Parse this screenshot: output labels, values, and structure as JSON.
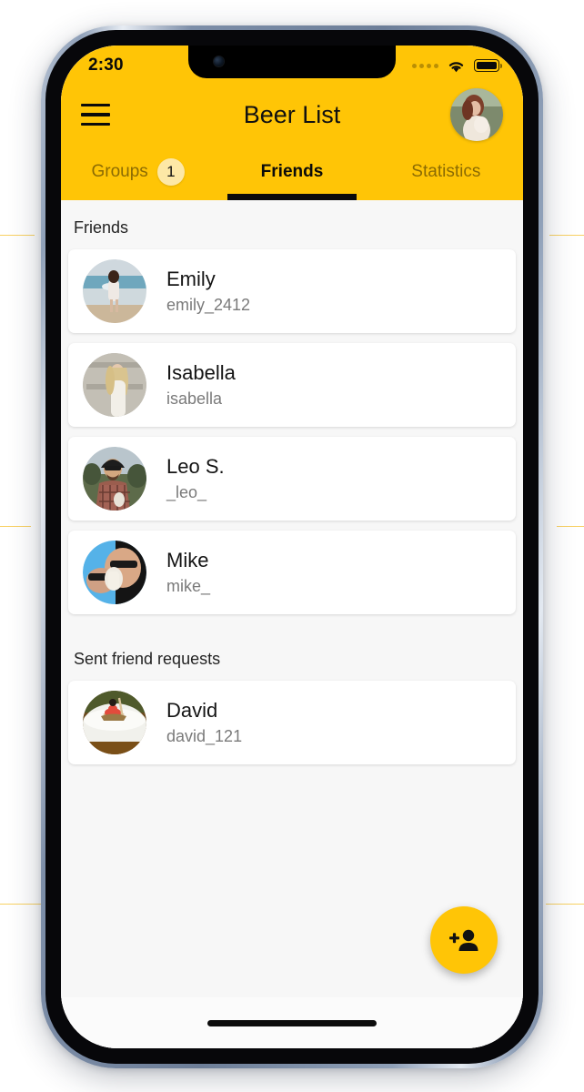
{
  "status_bar": {
    "time": "2:30",
    "cellular_icon": "signal-dots-icon",
    "wifi_icon": "wifi-icon",
    "battery_icon": "battery-full-icon"
  },
  "nav": {
    "menu_icon": "hamburger-menu-icon",
    "title": "Beer List",
    "avatar_icon": "user-avatar"
  },
  "tabs": [
    {
      "label": "Groups",
      "badge": "1",
      "active": false
    },
    {
      "label": "Friends",
      "badge": "",
      "active": true
    },
    {
      "label": "Statistics",
      "badge": "",
      "active": false
    }
  ],
  "sections": [
    {
      "title": "Friends",
      "items": [
        {
          "name": "Emily",
          "handle": "emily_2412"
        },
        {
          "name": "Isabella",
          "handle": "isabella"
        },
        {
          "name": "Leo S.",
          "handle": "_leo_"
        },
        {
          "name": "Mike",
          "handle": "mike_"
        }
      ]
    },
    {
      "title": "Sent friend requests",
      "items": [
        {
          "name": "David",
          "handle": "david_121"
        }
      ]
    }
  ],
  "fab": {
    "icon": "person-add-icon",
    "label": "Add friend"
  },
  "colors": {
    "accent": "#FFC506",
    "badge_bg": "#FDE8A6",
    "card_bg": "#FFFFFF",
    "page_bg": "#F7F7F7",
    "text_primary": "#141414",
    "text_secondary": "#7A7A7A"
  }
}
